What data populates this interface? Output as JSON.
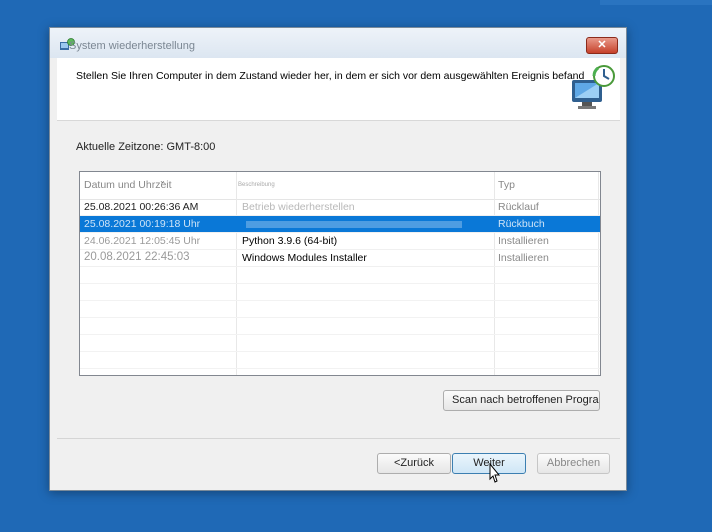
{
  "window": {
    "title": "System wiederherstellung",
    "close_glyph": "✕"
  },
  "header": {
    "text": "Stellen Sie Ihren Computer in dem Zustand wieder her, in dem er sich vor dem ausgewählten Ereignis befand",
    "icon": "system-restore-icon"
  },
  "timezone": "Aktuelle Zeitzone: GMT-8:00",
  "list": {
    "columns": [
      "Datum und Uhrzeit",
      "Beschreibung",
      "Typ"
    ],
    "rows": [
      {
        "date": "25.08.2021 00:26:36 AM",
        "description": "Betrieb wiederherstellen",
        "type": "Rücklauf"
      },
      {
        "date": "25.08.2021 00:19:18 Uhr",
        "description": "",
        "type": "Rückbuch"
      },
      {
        "date": "24.06.2021 12:05:45 Uhr",
        "description": "Python 3.9.6 (64-bit)",
        "type": "Installieren"
      },
      {
        "date": "20.08.2021 22:45:03",
        "description": "Windows Modules Installer",
        "type": "Installieren"
      }
    ]
  },
  "buttons": {
    "scan": "Scan nach betroffenen Programmen",
    "back": "<Zurück",
    "next": "Weiter",
    "cancel": "Abbrechen"
  },
  "colors": {
    "desktop": "#1f69b6",
    "selection": "#0a78d7",
    "close": "#c6412b"
  }
}
